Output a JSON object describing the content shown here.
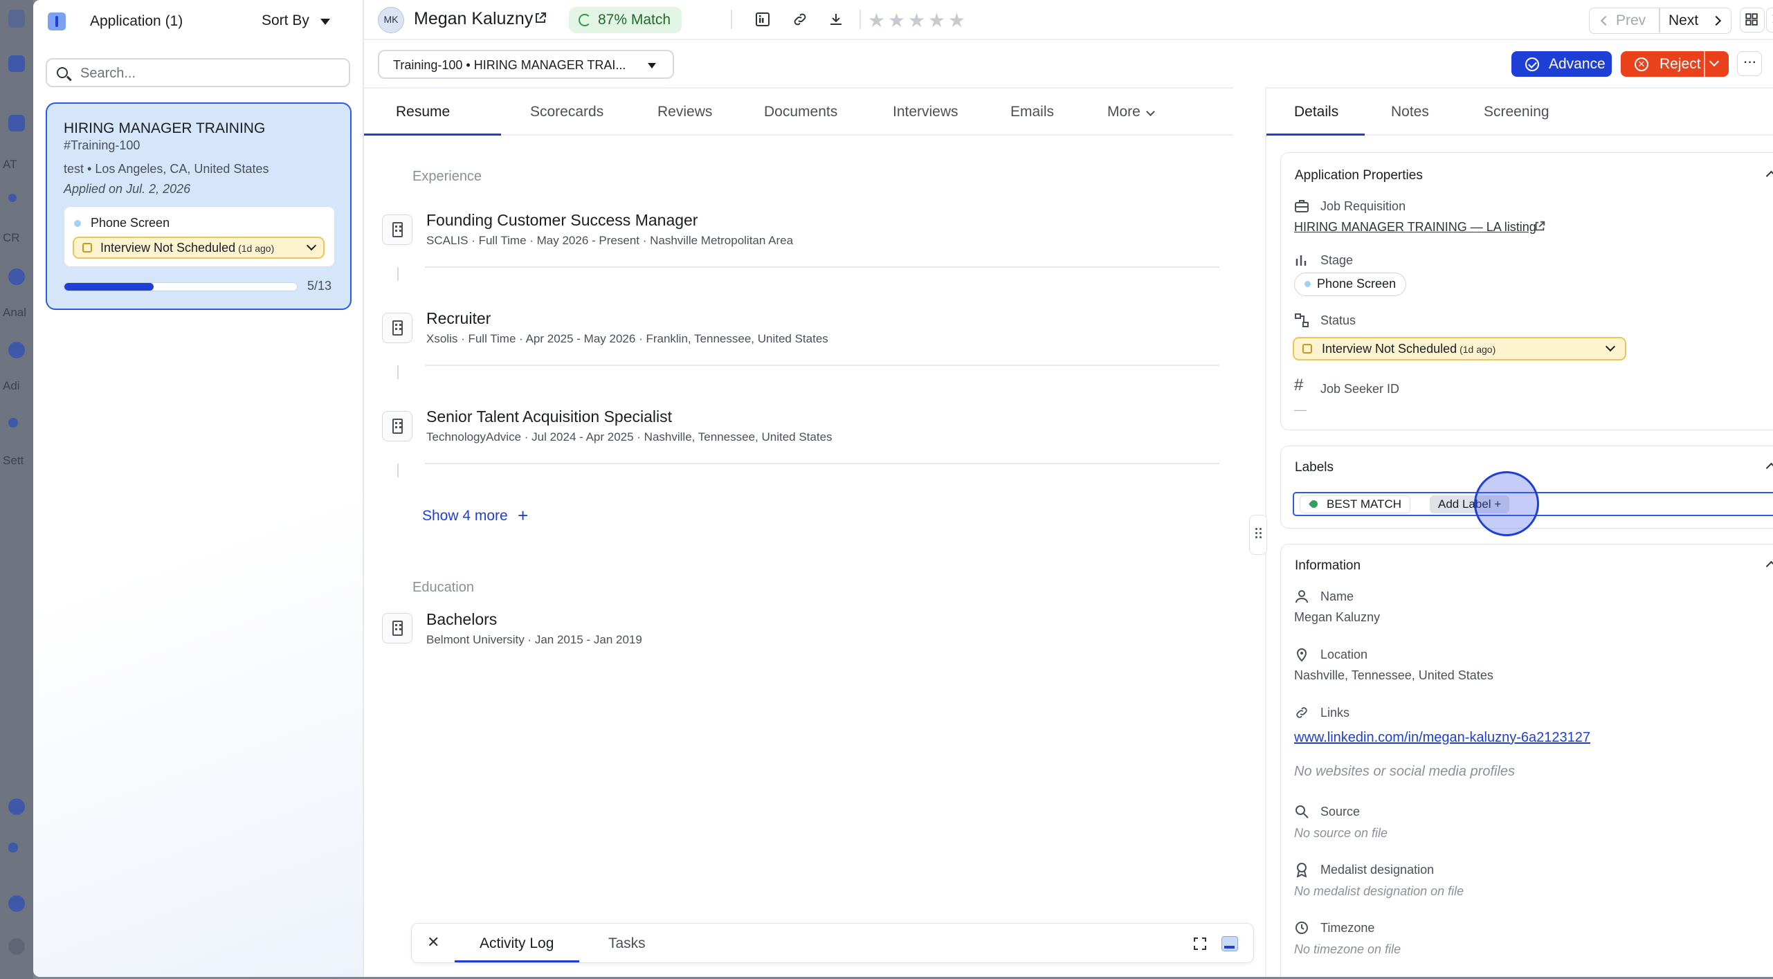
{
  "left_panel": {
    "title": "Application (1)",
    "sort_label": "Sort By",
    "search_placeholder": "Search...",
    "card": {
      "job_title": "HIRING MANAGER TRAINING",
      "job_id": "#Training-100",
      "location": "test • Los Angeles, CA, United States",
      "applied": "Applied on Jul. 2, 2026",
      "stage": "Phone Screen",
      "status": "Interview Not Scheduled",
      "status_age": "(1d ago)",
      "progress_text": "5/13",
      "progress_fraction": 0.385
    }
  },
  "header": {
    "initials": "MK",
    "name": "Megan Kaluzny",
    "match": "87% Match",
    "rating_max": 5,
    "prev_label": "Prev",
    "next_label": "Next",
    "job_selector": "Training-100 • HIRING MANAGER TRAI...",
    "advance_label": "Advance",
    "reject_label": "Reject",
    "more_label": "···"
  },
  "main_tabs": [
    "Resume",
    "Scorecards",
    "Reviews",
    "Documents",
    "Interviews",
    "Emails",
    "More"
  ],
  "resume": {
    "experience_label": "Experience",
    "experience": [
      {
        "title": "Founding Customer Success Manager",
        "detail": "SCALIS · Full Time · May 2026 - Present · Nashville Metropolitan Area"
      },
      {
        "title": "Recruiter",
        "detail": "Xsolis · Full Time · Apr 2025 - May 2026 · Franklin, Tennessee, United States"
      },
      {
        "title": "Senior Talent Acquisition Specialist",
        "detail": "TechnologyAdvice · Jul 2024 - Apr 2025 · Nashville, Tennessee, United States"
      }
    ],
    "show_more": "Show 4 more",
    "show_more_icon": "+",
    "education_label": "Education",
    "education": [
      {
        "title": "Bachelors",
        "detail": "Belmont University · Jan 2015 - Jan 2019"
      }
    ]
  },
  "activity": {
    "close": "✕",
    "tab1": "Activity Log",
    "tab2": "Tasks"
  },
  "side_tabs": [
    "Details",
    "Notes",
    "Screening"
  ],
  "details": {
    "app_props_title": "Application Properties",
    "job_req_label": "Job Requisition",
    "job_req_value": "HIRING MANAGER TRAINING — LA listing",
    "stage_label": "Stage",
    "stage_value": "Phone Screen",
    "status_label": "Status",
    "status_value": "Interview Not Scheduled",
    "status_age": "(1d ago)",
    "seeker_label": "Job Seeker ID",
    "seeker_value": "—",
    "labels_title": "Labels",
    "label_chip": "BEST MATCH",
    "add_label": "Add Label  +",
    "info_title": "Information",
    "name_label": "Name",
    "name_value": "Megan Kaluzny",
    "location_label": "Location",
    "location_value": "Nashville, Tennessee, United States",
    "links_label": "Links",
    "links_value": "www.linkedin.com/in/megan-kaluzny-6a2123127",
    "links_empty": "No websites or social media profiles",
    "source_label": "Source",
    "source_empty": "No source on file",
    "medalist_label": "Medalist designation",
    "medalist_empty": "No medalist designation on file",
    "timezone_label": "Timezone",
    "timezone_empty": "No timezone on file"
  },
  "colors": {
    "primary": "#1d3fd6",
    "reject": "#e8411c",
    "match_bg": "#e3f5e4",
    "status_bg": "#fdf4cf",
    "card_bg": "#d5e6fb"
  }
}
